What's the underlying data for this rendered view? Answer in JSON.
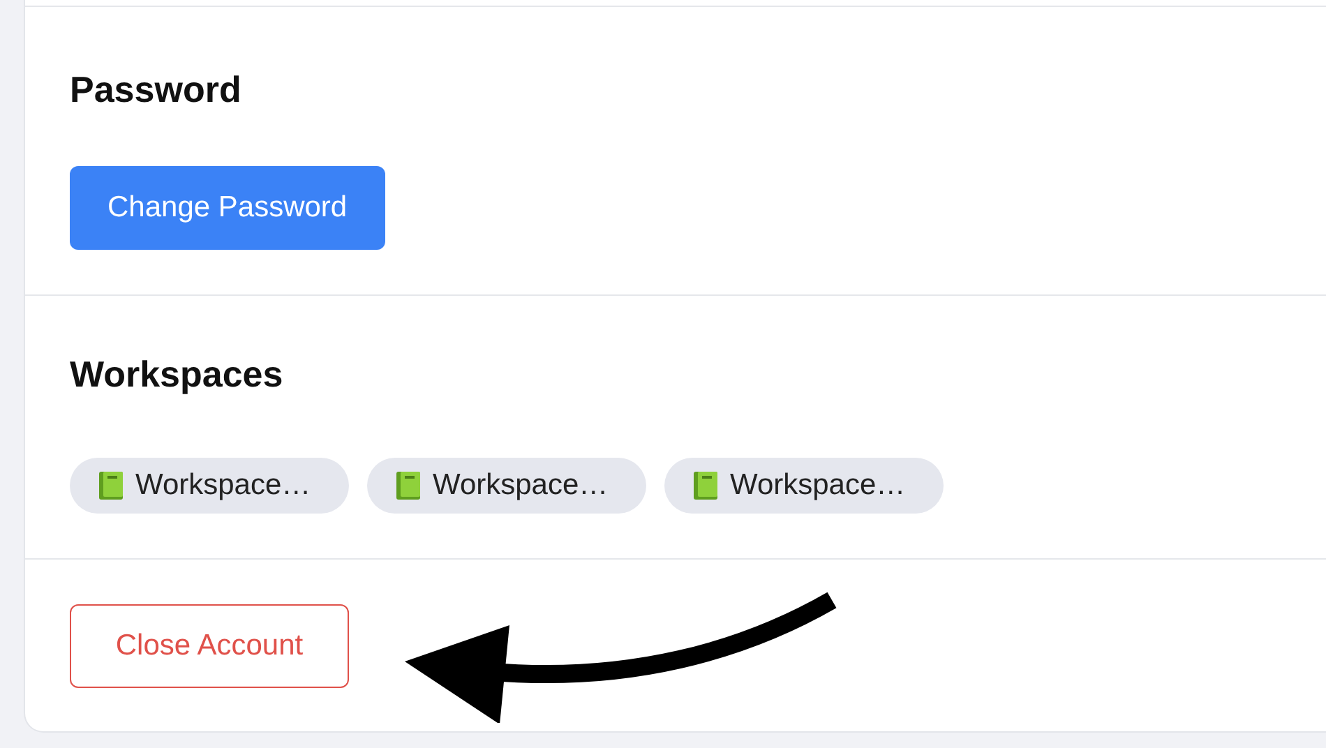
{
  "password_section": {
    "heading": "Password",
    "button": "Change Password"
  },
  "workspaces_section": {
    "heading": "Workspaces",
    "workspaces": [
      {
        "label": "Workspace…"
      },
      {
        "label": "Workspace…"
      },
      {
        "label": "Workspace…"
      }
    ]
  },
  "close_account_button": "Close Account"
}
